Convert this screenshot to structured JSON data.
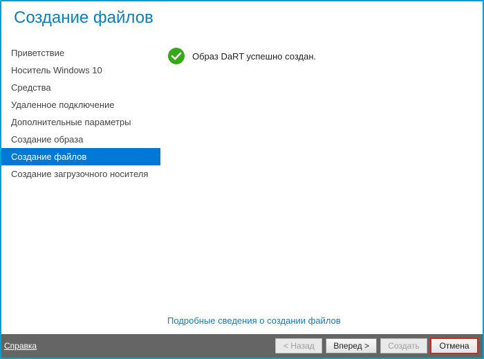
{
  "header": {
    "title": "Создание файлов"
  },
  "sidebar": {
    "items": [
      {
        "label": "Приветствие",
        "selected": false
      },
      {
        "label": "Носитель Windows 10",
        "selected": false
      },
      {
        "label": "Средства",
        "selected": false
      },
      {
        "label": "Удаленное подключение",
        "selected": false
      },
      {
        "label": "Дополнительные параметры",
        "selected": false
      },
      {
        "label": "Создание образа",
        "selected": false
      },
      {
        "label": "Создание файлов",
        "selected": true
      },
      {
        "label": "Создание загрузочного носителя",
        "selected": false
      }
    ]
  },
  "main": {
    "status_icon": "check-circle",
    "status_color": "#37a818",
    "status_text": "Образ DaRT успешно создан.",
    "details_link": "Подробные сведения о создании файлов"
  },
  "footer": {
    "help": "Справка",
    "buttons": {
      "back": {
        "label": "< Назад",
        "enabled": false
      },
      "next": {
        "label": "Вперед >",
        "enabled": true
      },
      "create": {
        "label": "Создать",
        "enabled": false
      },
      "cancel": {
        "label": "Отмена",
        "enabled": true,
        "highlight": true
      }
    }
  }
}
